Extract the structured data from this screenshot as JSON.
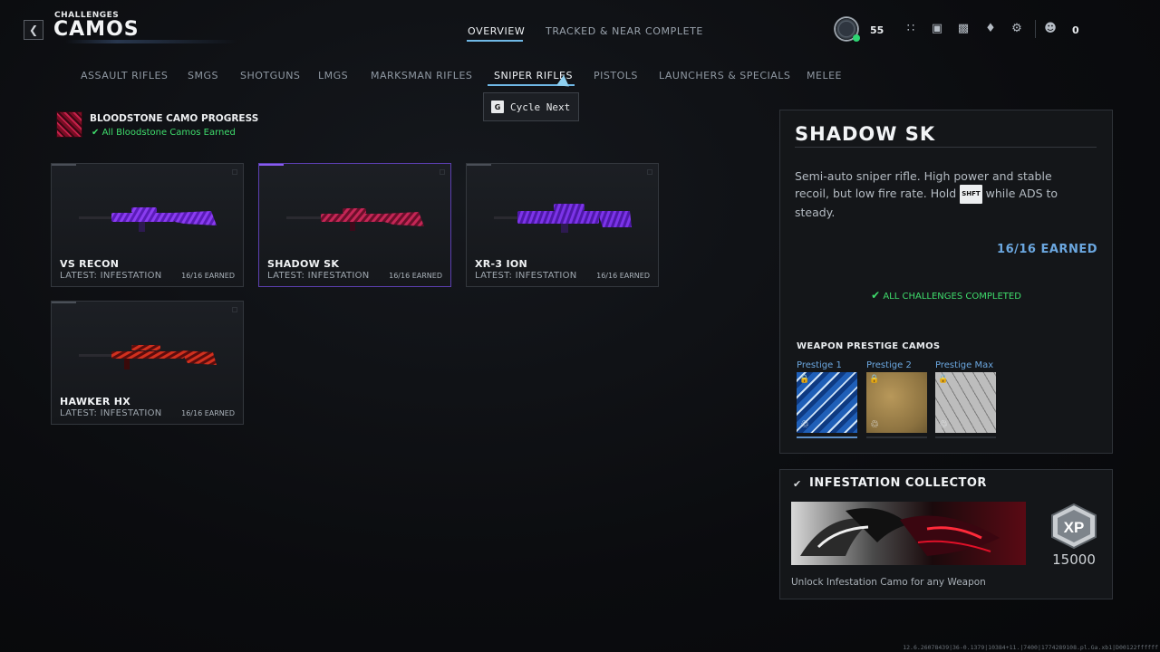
{
  "header": {
    "breadcrumb": "CHALLENGES",
    "title": "CAMOS",
    "tabs": [
      {
        "label": "OVERVIEW",
        "active": true
      },
      {
        "label": "TRACKED & NEAR COMPLETE",
        "active": false
      }
    ],
    "level": "55",
    "friends_count": "0",
    "icons": [
      "level-badge-icon",
      "apps-grid-icon",
      "store-icon",
      "media-icon",
      "notification-bell-icon",
      "settings-gear-icon",
      "friends-icon"
    ]
  },
  "categories": [
    {
      "label": "ASSAULT RIFLES",
      "active": false
    },
    {
      "label": "SMGS",
      "active": false
    },
    {
      "label": "SHOTGUNS",
      "active": false
    },
    {
      "label": "LMGS",
      "active": false
    },
    {
      "label": "MARKSMAN RIFLES",
      "active": false
    },
    {
      "label": "SNIPER RIFLES",
      "active": true
    },
    {
      "label": "PISTOLS",
      "active": false
    },
    {
      "label": "LAUNCHERS & SPECIALS",
      "active": false
    },
    {
      "label": "MELEE",
      "active": false
    }
  ],
  "tooltip": {
    "key": "G",
    "label": "Cycle Next"
  },
  "bloodstone": {
    "title": "BLOODSTONE CAMO PROGRESS",
    "status": "All Bloodstone Camos Earned"
  },
  "weapons": [
    {
      "name": "VS RECON",
      "latest": "LATEST: INFESTATION",
      "earned": "16/16 EARNED",
      "selected": false,
      "camo": "purple"
    },
    {
      "name": "SHADOW SK",
      "latest": "LATEST: INFESTATION",
      "earned": "16/16 EARNED",
      "selected": true,
      "camo": "red"
    },
    {
      "name": "XR-3 ION",
      "latest": "LATEST: INFESTATION",
      "earned": "16/16 EARNED",
      "selected": false,
      "camo": "purple"
    },
    {
      "name": "HAWKER HX",
      "latest": "LATEST: INFESTATION",
      "earned": "16/16 EARNED",
      "selected": false,
      "camo": "red"
    }
  ],
  "detail": {
    "title": "SHADOW SK",
    "description_before": "Semi-auto sniper rifle. High power and stable recoil, but low fire rate. Hold",
    "shift_key": "SHFT",
    "description_after": "while ADS to steady.",
    "earned": "16/16 EARNED",
    "status": "ALL CHALLENGES COMPLETED",
    "prestige_heading": "WEAPON PRESTIGE CAMOS",
    "prestige": [
      {
        "label": "Prestige 1",
        "style": "blue"
      },
      {
        "label": "Prestige 2",
        "style": "gold"
      },
      {
        "label": "Prestige Max",
        "style": "stone"
      }
    ]
  },
  "collector": {
    "title": "INFESTATION COLLECTOR",
    "xp_label": "XP",
    "xp": "15000",
    "description": "Unlock Infestation Camo for any Weapon"
  },
  "version": "12.6.26078439|36-0.1379|10384+11.|7400|1774289108.pl.Ga.xb1|D00122ffffff"
}
